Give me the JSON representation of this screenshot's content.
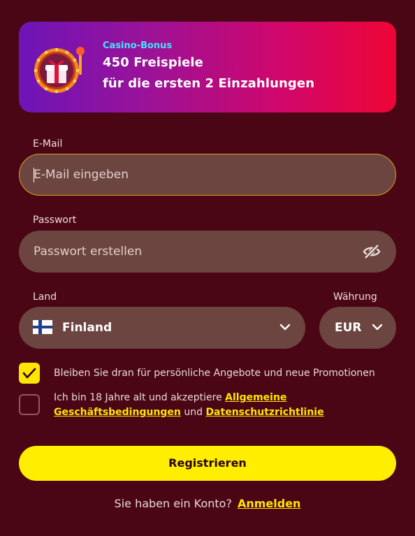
{
  "banner": {
    "label": "Casino-Bonus",
    "line1": "450 Freispiele",
    "line2": "für die ersten 2 Einzahlungen",
    "icon": "slot-machine-gift-icon"
  },
  "email": {
    "label": "E-Mail",
    "placeholder": "E-Mail eingeben"
  },
  "password": {
    "label": "Passwort",
    "placeholder": "Passwort erstellen",
    "icon": "eye-off-icon"
  },
  "country": {
    "label": "Land",
    "value": "Finland",
    "flag": "finland-flag-icon"
  },
  "currency": {
    "label": "Währung",
    "value": "EUR"
  },
  "consent": {
    "promotions_text": "Bleiben Sie dran für persönliche Angebote und neue Promotionen",
    "promotions_checked": true,
    "terms_prefix": "Ich bin 18 Jahre alt und akzeptiere ",
    "terms_link": "Allgemeine Geschäftsbedingungen",
    "terms_middle": " und ",
    "privacy_link": "Datenschutzrichtlinie",
    "terms_checked": false
  },
  "actions": {
    "register_label": "Registrieren",
    "login_prompt": "Sie haben ein Konto?",
    "login_link": "Anmelden"
  },
  "colors": {
    "background": "#4a0614",
    "input_bg": "#6c4540",
    "accent_yellow": "#ffee00",
    "bonus_label": "#4ce0ff"
  }
}
